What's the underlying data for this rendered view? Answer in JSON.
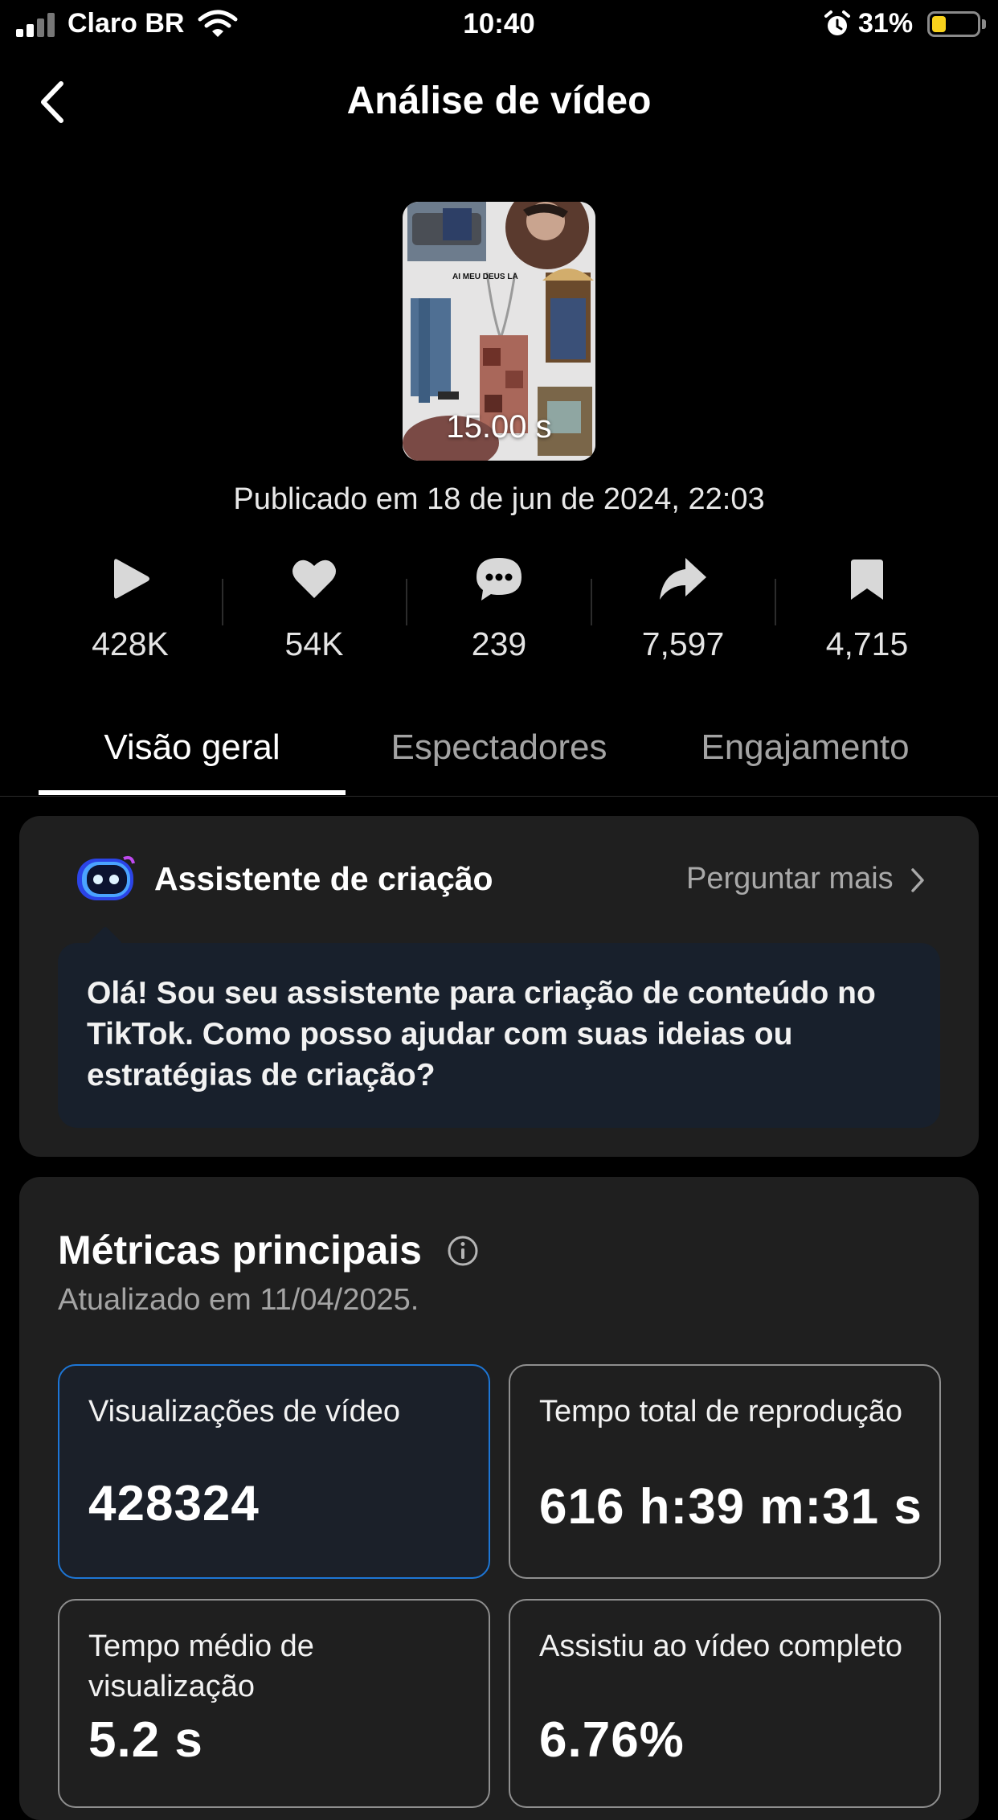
{
  "status_bar": {
    "carrier": "Claro BR",
    "time": "10:40",
    "battery_percent": "31%",
    "battery_level": 0.31,
    "icons": [
      "signal-icon",
      "wifi-icon",
      "alarm-icon",
      "battery-icon"
    ]
  },
  "header": {
    "title": "Análise de vídeo",
    "back_icon": "chevron-left-icon"
  },
  "video": {
    "duration": "15.00 s",
    "published": "Publicado em 18 de jun de 2024, 22:03",
    "thumbnail_text": "AI MEU DEUS LA"
  },
  "stats": [
    {
      "icon": "play-icon",
      "value": "428K"
    },
    {
      "icon": "heart-icon",
      "value": "54K"
    },
    {
      "icon": "comment-icon",
      "value": "239"
    },
    {
      "icon": "share-icon",
      "value": "7,597"
    },
    {
      "icon": "bookmark-icon",
      "value": "4,715"
    }
  ],
  "tabs": [
    {
      "label": "Visão geral",
      "active": true
    },
    {
      "label": "Espectadores",
      "active": false
    },
    {
      "label": "Engajamento",
      "active": false
    }
  ],
  "assistant": {
    "title": "Assistente de criação",
    "ask_more": "Perguntar mais",
    "message": "Olá! Sou seu assistente para criação de conteúdo no TikTok. Como posso ajudar com suas ideias ou estratégias de criação?"
  },
  "metrics": {
    "title": "Métricas principais",
    "updated": "Atualizado em 11/04/2025.",
    "items": [
      {
        "label": "Visualizações de vídeo",
        "value": "428324",
        "selected": true
      },
      {
        "label": "Tempo total de reprodução",
        "value": "616 h:39 m:31 s",
        "selected": false
      },
      {
        "label": "Tempo médio de visualização",
        "value": "5.2 s",
        "selected": false
      },
      {
        "label": "Assistiu ao vídeo completo",
        "value": "6.76%",
        "selected": false
      }
    ]
  },
  "colors": {
    "background": "#000000",
    "card": "#1f1f1f",
    "accent_blue": "#1d76d6",
    "battery_yellow": "#f8d21c",
    "muted_text": "#a4a4a4"
  }
}
